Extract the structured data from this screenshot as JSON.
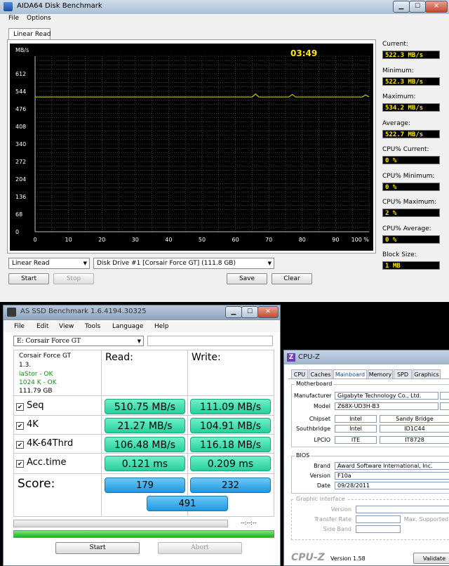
{
  "aida": {
    "title": "AIDA64 Disk Benchmark",
    "menu": [
      "File",
      "Options"
    ],
    "tab": "Linear Read",
    "chart": {
      "yunit": "MB/s",
      "timer": "03:49"
    },
    "stats": [
      {
        "label": "Current:",
        "value": "522.3 MB/s"
      },
      {
        "label": "Minimum:",
        "value": "522.3 MB/s"
      },
      {
        "label": "Maximum:",
        "value": "534.2 MB/s"
      },
      {
        "label": "Average:",
        "value": "522.7 MB/s"
      },
      {
        "label": "CPU% Current:",
        "value": "0 %"
      },
      {
        "label": "CPU% Minimum:",
        "value": "0 %"
      },
      {
        "label": "CPU% Maximum:",
        "value": "2 %"
      },
      {
        "label": "CPU% Average:",
        "value": "0 %"
      },
      {
        "label": "Block Size:",
        "value": "1 MB"
      }
    ],
    "test_select": "Linear Read",
    "drive_select": "Disk Drive #1  [Corsair Force GT]  (111.8 GB)",
    "buttons": {
      "start": "Start",
      "stop": "Stop",
      "save": "Save",
      "clear": "Clear"
    }
  },
  "chart_data": {
    "type": "line",
    "title": "",
    "xlabel": "",
    "ylabel": "MB/s",
    "xlim": [
      0,
      100
    ],
    "ylim": [
      0,
      680
    ],
    "x_ticks": [
      "0",
      "10",
      "20",
      "30",
      "40",
      "50",
      "60",
      "70",
      "80",
      "90",
      "100 %"
    ],
    "y_ticks": [
      "0",
      "68",
      "136",
      "204",
      "272",
      "340",
      "408",
      "476",
      "544",
      "612"
    ],
    "grid": true,
    "series": [
      {
        "x": [
          0,
          10,
          20,
          30,
          40,
          50,
          60,
          65,
          66,
          67,
          70,
          76,
          77,
          78,
          80,
          90,
          98,
          99,
          100
        ],
        "y": [
          522,
          522,
          522,
          522,
          522,
          522,
          522,
          522,
          534,
          522,
          522,
          522,
          532,
          522,
          522,
          522,
          522,
          530,
          522
        ],
        "color": "#e6dd00"
      }
    ]
  },
  "asssd": {
    "title": "AS SSD Benchmark 1.6.4194.30325",
    "menu": [
      "File",
      "Edit",
      "View",
      "Tools",
      "Language",
      "Help"
    ],
    "drive_select": "E: Corsair Force GT",
    "info": {
      "model": "Corsair Force GT",
      "firmware": "1.3.",
      "driver": "iaStor - OK",
      "align": "1024 K - OK",
      "size": "111.79 GB"
    },
    "headers": {
      "read": "Read:",
      "write": "Write:"
    },
    "rows": [
      {
        "name": "Seq",
        "read": "510.75 MB/s",
        "write": "111.09 MB/s"
      },
      {
        "name": "4K",
        "read": "21.27 MB/s",
        "write": "104.91 MB/s"
      },
      {
        "name": "4K-64Thrd",
        "read": "106.48 MB/s",
        "write": "116.18 MB/s"
      },
      {
        "name": "Acc.time",
        "read": "0.121 ms",
        "write": "0.209 ms"
      }
    ],
    "score_label": "Score:",
    "score_read": "179",
    "score_write": "232",
    "score_total": "491",
    "time": "--:--:--",
    "progress_bottom": 1.0,
    "buttons": {
      "start": "Start",
      "abort": "Abort"
    }
  },
  "cpuz": {
    "title": "CPU-Z",
    "tabs": [
      "CPU",
      "Caches",
      "Mainboard",
      "Memory",
      "SPD",
      "Graphics"
    ],
    "active_tab": "Mainboard",
    "motherboard": {
      "group": "Motherboard",
      "manufacturer_label": "Manufacturer",
      "manufacturer": "Gigabyte Technology Co., Ltd.",
      "model_label": "Model",
      "model": "Z68X-UD3H-B3",
      "chipset_label": "Chipset",
      "chipset_vendor": "Intel",
      "chipset": "Sandy Bridge",
      "southbridge_label": "Southbridge",
      "southbridge_vendor": "Intel",
      "southbridge": "ID1C44",
      "lpcio_label": "LPCIO",
      "lpcio_vendor": "ITE",
      "lpcio": "IT8728"
    },
    "bios": {
      "group": "BIOS",
      "brand_label": "Brand",
      "brand": "Award Software International, Inc.",
      "version_label": "Version",
      "version": "F10a",
      "date_label": "Date",
      "date": "09/28/2011"
    },
    "graphic": {
      "group": "Graphic Interface",
      "version_label": "Version",
      "transfer_label": "Transfer Rate",
      "max_label": "Max. Supported",
      "side_label": "Side Band"
    },
    "footer_logo": "CPU-Z",
    "footer_version": "Version 1.58",
    "validate": "Validate"
  },
  "colors": {
    "chart_bg": "#000000",
    "chart_grid": "#6e6e6e",
    "line": "#e6dd00",
    "value_text": "#ffea00"
  }
}
